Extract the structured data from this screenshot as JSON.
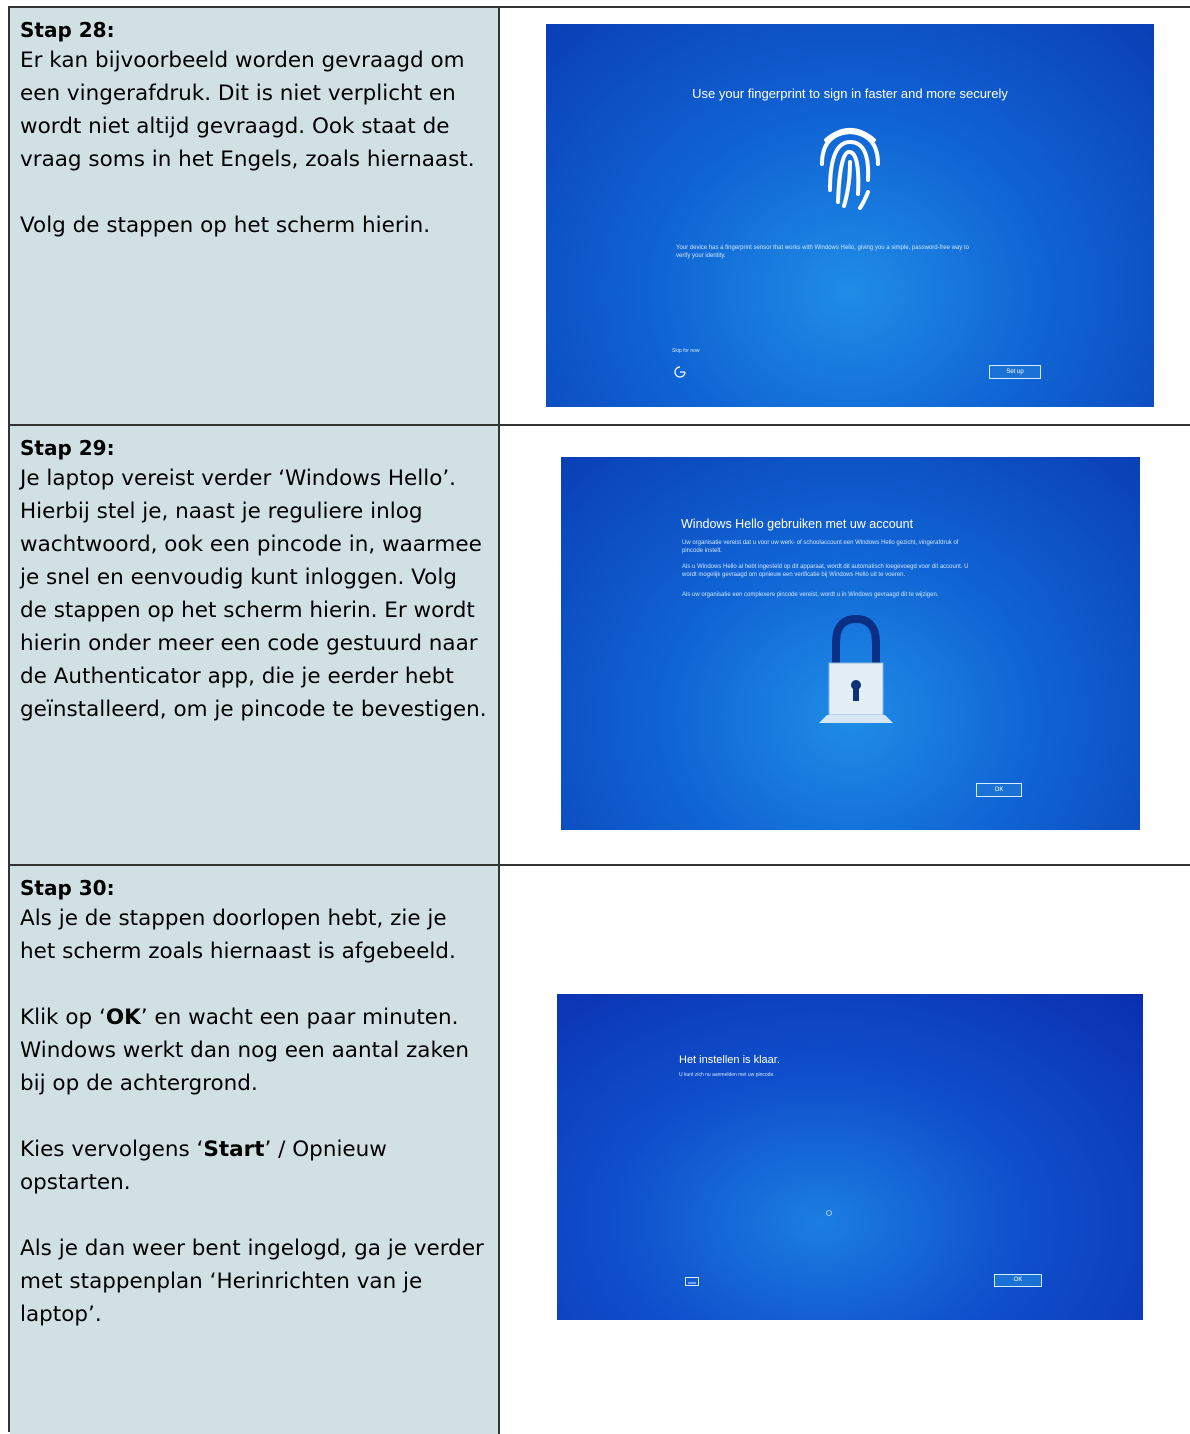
{
  "steps": [
    {
      "title": "Stap 28:",
      "paragraphs": [
        "Er kan bijvoorbeeld worden gevraagd om een vingerafdruk. Dit is niet verplicht en wordt niet altijd gevraagd. Ook staat de vraag soms in het Engels, zoals hiernaast.",
        "Volg de stappen op het scherm hierin."
      ],
      "screen": {
        "heading": "Use your fingerprint to sign in faster and more securely",
        "body": "Your device has a fingerprint sensor that works with Windows Hello, giving you a simple, password-free way to verify your identity.",
        "skip_link": "Skip for now",
        "button": "Set up",
        "icon": "fingerprint-icon"
      }
    },
    {
      "title": "Stap 29:",
      "paragraphs": [
        "Je laptop vereist verder ‘Windows Hello’. Hierbij stel je, naast je reguliere inlog wachtwoord, ook een pincode in, waarmee je snel en eenvoudig kunt inloggen. Volg de stappen op het scherm hierin. Er wordt hierin onder meer een code gestuurd naar de Authenticator app, die je eerder hebt geïnstalleerd, om je pincode te bevestigen."
      ],
      "screen": {
        "heading": "Windows Hello gebruiken met uw account",
        "body1": "Uw organisatie vereist dat u voor uw werk- of schoolaccount een Windows Hello gezicht, vingerafdruk of pincode instelt.",
        "body2": "Als u Windows Hello al hebt ingesteld op dit apparaat, wordt dit automatisch toegevoegd voor dit account. U wordt mogelijk gevraagd om opnieuw een verificatie bij Windows Hello uit te voeren.",
        "body3": "Als uw organisatie een complexere pincode vereist, wordt u in Windows gevraagd dit te wijzigen.",
        "button": "OK",
        "icon": "padlock-icon"
      }
    },
    {
      "title": "Stap 30:",
      "paragraphs": [
        "Als je de stappen doorlopen hebt, zie je het scherm zoals hiernaast is afgebeeld.",
        "Klik op ‘OK’ en wacht een paar minuten. Windows werkt dan nog een aantal zaken bij op de achtergrond.",
        "Kies vervolgens ‘Start’  / Opnieuw opstarten.",
        "Als je dan weer bent ingelogd, ga je verder met stappenplan ‘Herinrichten van je laptop’."
      ],
      "bold_words": [
        "OK",
        "Start"
      ],
      "screen": {
        "heading": "Het instellen is klaar.",
        "body": "U kunt zich nu aanmelden met uw pincode.",
        "button": "OK",
        "icon": "keyboard-icon"
      }
    }
  ]
}
